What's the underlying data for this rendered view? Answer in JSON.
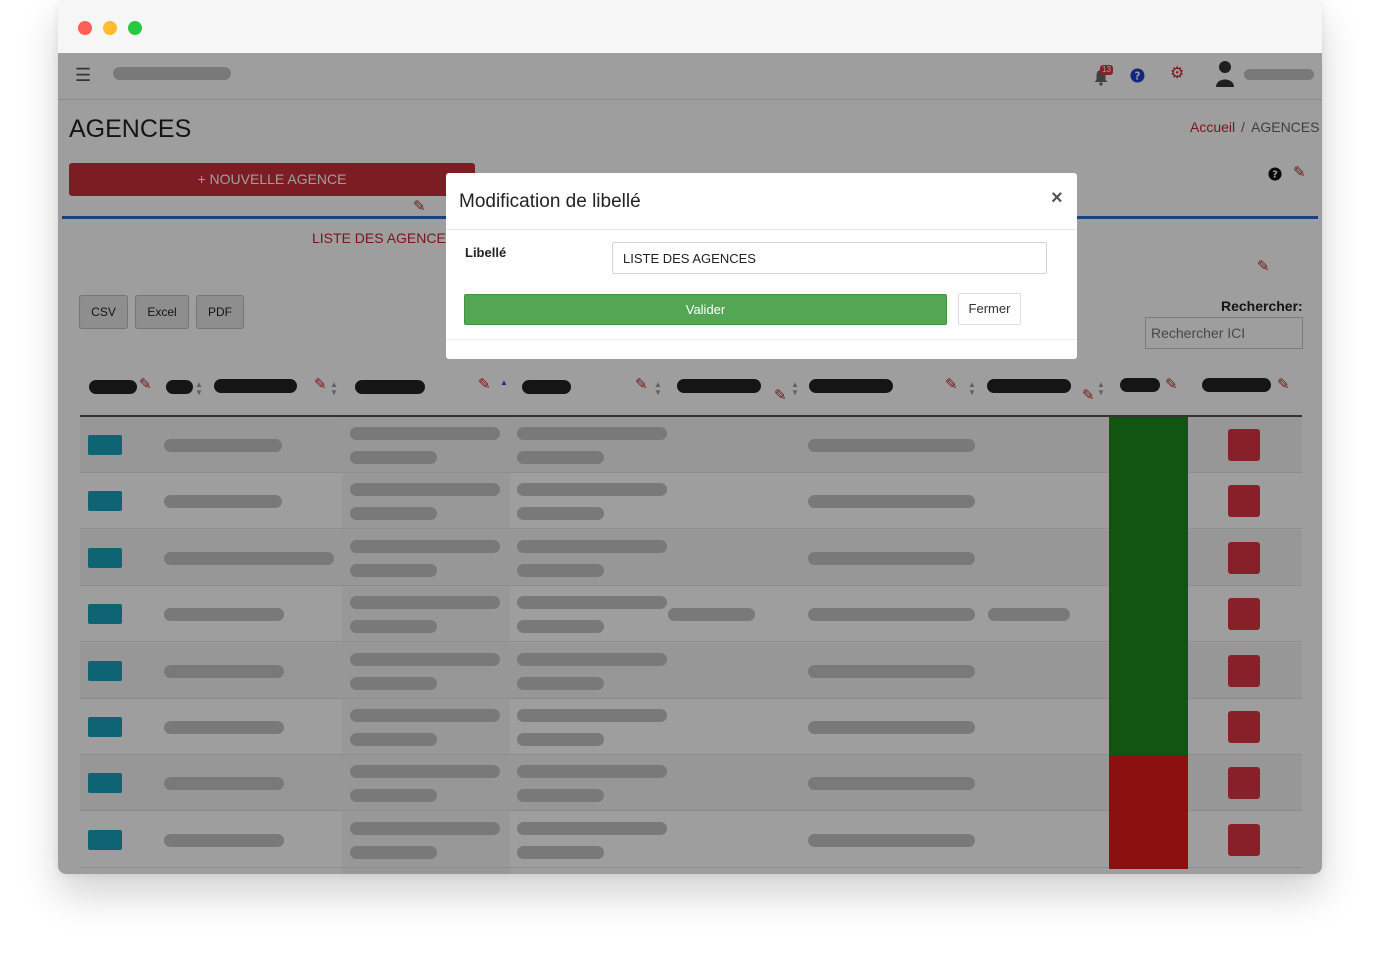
{
  "window": {
    "traffic_lights": [
      "#fe5f57",
      "#febc2e",
      "#28c840"
    ]
  },
  "navbar": {
    "menu_icon": "hamburger-icon",
    "notification_count": "13"
  },
  "page": {
    "title": "AGENCES",
    "breadcrumb_home": "Accueil",
    "breadcrumb_separator": "/",
    "breadcrumb_current": "AGENCES",
    "new_button": "+ NOUVELLE AGENCE",
    "tab_title": "LISTE DES AGENCES"
  },
  "toolbar": {
    "export_buttons": [
      "CSV",
      "Excel",
      "PDF"
    ],
    "search_label": "Rechercher:",
    "search_placeholder": "Rechercher ICI"
  },
  "table": {
    "row_status": [
      "green",
      "green",
      "green",
      "green",
      "green",
      "green",
      "red",
      "red"
    ],
    "status_colors": {
      "green": "#1a8a1a",
      "red": "#e01b1b"
    }
  },
  "modal": {
    "title": "Modification de libellé",
    "close": "×",
    "field_label": "Libellé",
    "field_value": "LISTE DES AGENCES",
    "submit": "Valider",
    "cancel": "Fermer"
  },
  "colors": {
    "accent_red": "#c8303a",
    "blue_border": "#2b6dc9",
    "success": "#53a653",
    "teal": "#17a2b8"
  }
}
